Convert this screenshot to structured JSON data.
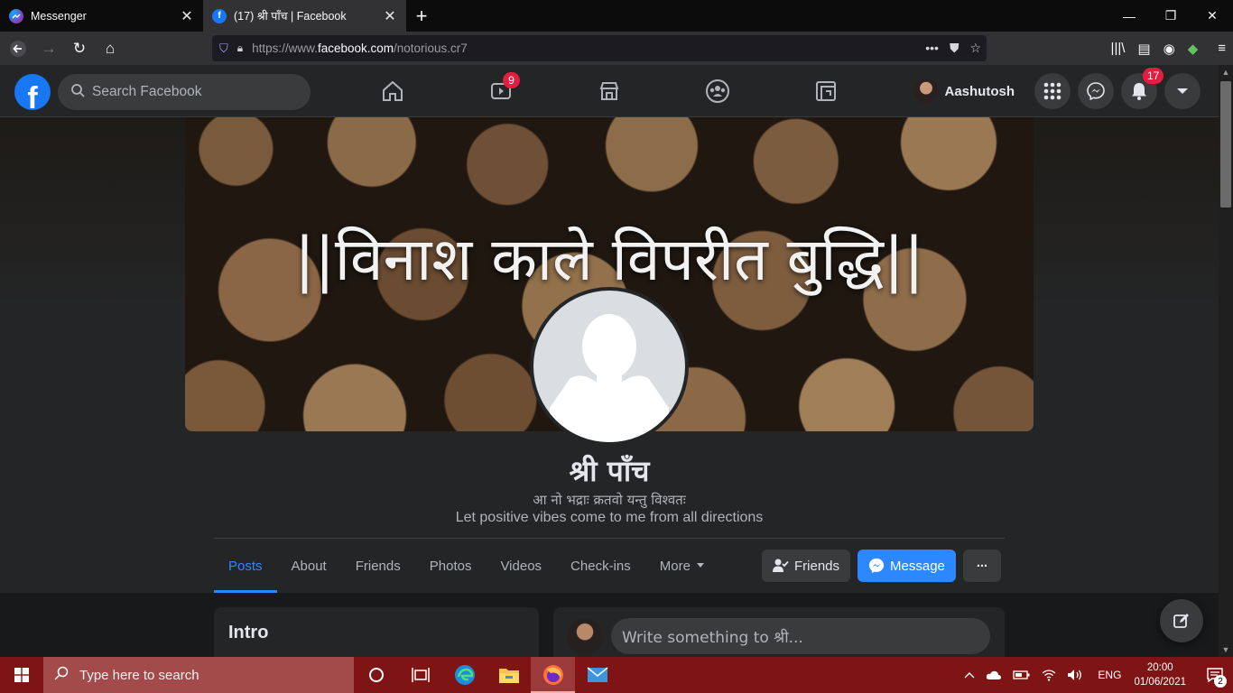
{
  "browser": {
    "tabs": [
      {
        "label": "Messenger",
        "favicon": "messenger-icon"
      },
      {
        "label": "(17) श्री पाँच | Facebook",
        "favicon": "facebook-icon"
      }
    ],
    "url": {
      "scheme": "https://www.",
      "host": "facebook.com",
      "path": "/notorious.cr7"
    }
  },
  "fb": {
    "search_placeholder": "Search Facebook",
    "watch_badge": "9",
    "user_name": "Aashutosh",
    "notif_badge": "17"
  },
  "profile": {
    "cover_text": "||विनाश काले विपरीत बुद्धि||",
    "name": "श्री पाँच",
    "bio_line1": "आ नो भद्राः क्रतवो यन्तु विश्वतः",
    "bio_line2": "Let positive vibes come to me from all directions",
    "tabs": [
      "Posts",
      "About",
      "Friends",
      "Photos",
      "Videos",
      "Check-ins",
      "More"
    ],
    "friends_btn": "Friends",
    "message_btn": "Message",
    "more_btn": "···"
  },
  "intro": {
    "title": "Intro"
  },
  "composer": {
    "placeholder": "Write something to श्री..."
  },
  "taskbar": {
    "search_placeholder": "Type here to search",
    "lang": "ENG",
    "time": "20:00",
    "date": "01/06/2021",
    "notif_count": "2"
  },
  "colors": {
    "accent": "#2d88ff",
    "fb_blue": "#1877f2",
    "badge_red": "#e41e3f",
    "taskbar": "#7f1414"
  }
}
